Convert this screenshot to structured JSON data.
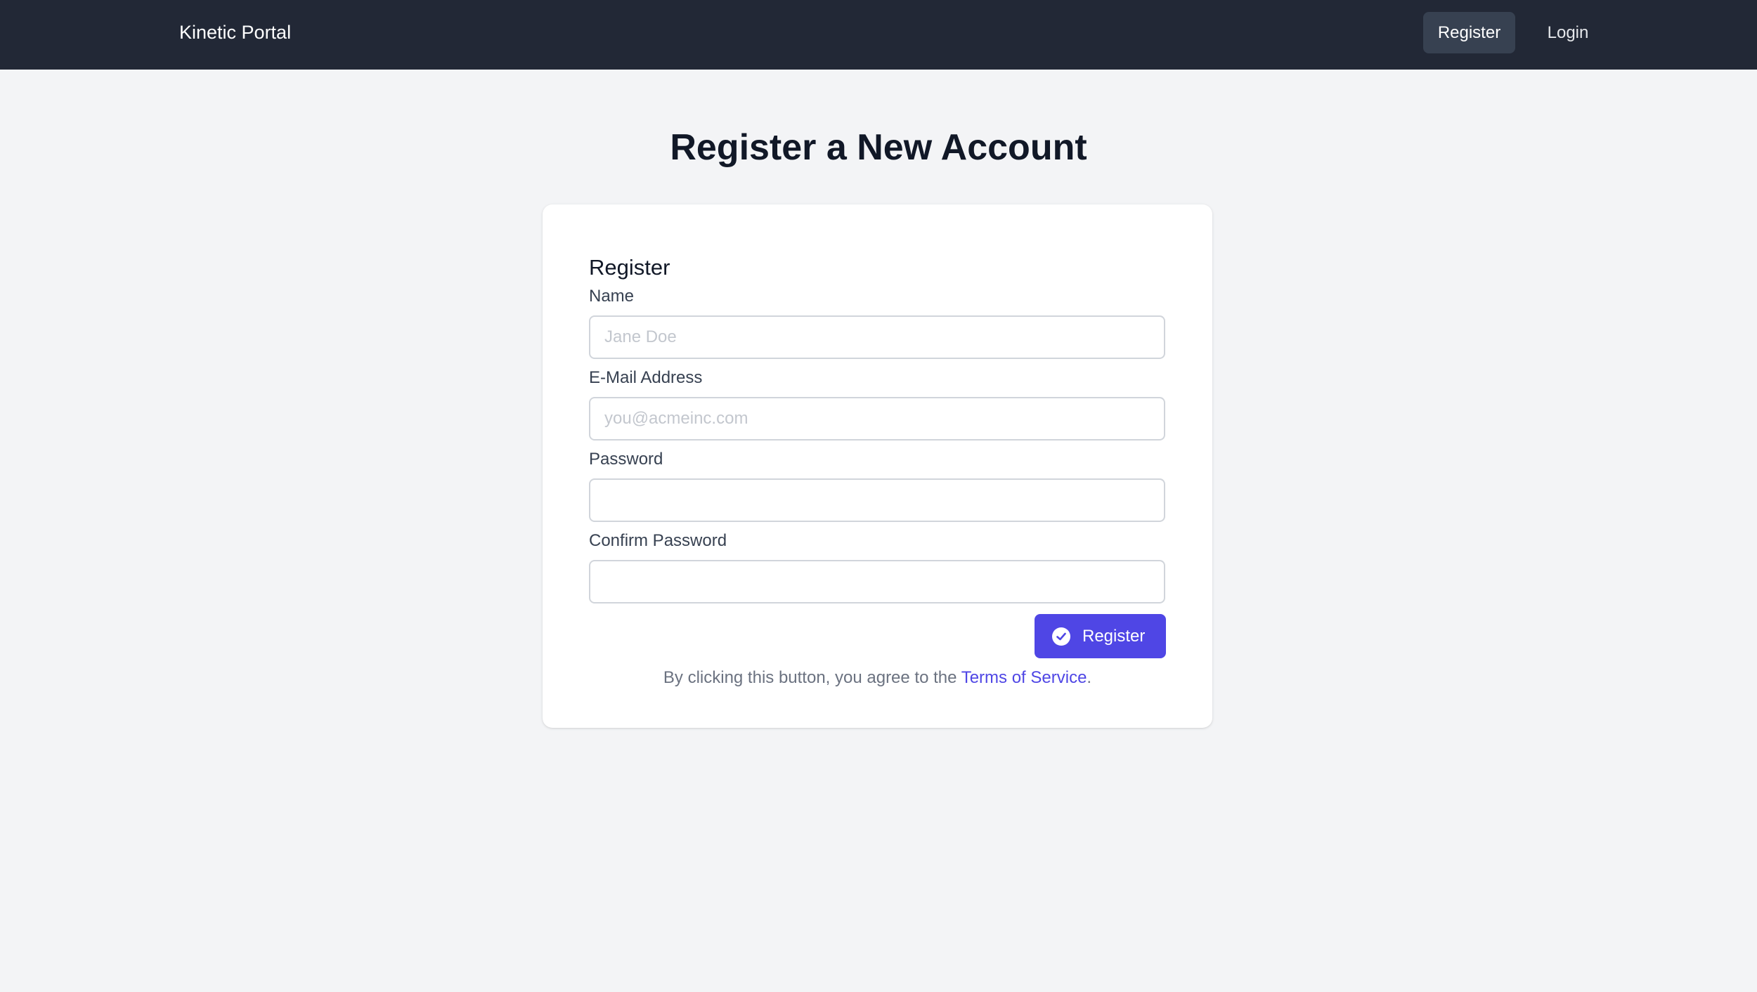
{
  "navbar": {
    "brand": "Kinetic Portal",
    "register_label": "Register",
    "login_label": "Login"
  },
  "page": {
    "title": "Register a New Account"
  },
  "form": {
    "heading": "Register",
    "fields": [
      {
        "label": "Name",
        "placeholder": "Jane Doe",
        "value": ""
      },
      {
        "label": "E-Mail Address",
        "placeholder": "you@acmeinc.com",
        "value": ""
      },
      {
        "label": "Password",
        "placeholder": "",
        "value": ""
      },
      {
        "label": "Confirm Password",
        "placeholder": "",
        "value": ""
      }
    ],
    "submit_label": "Register",
    "submit_icon": "check-circle-icon",
    "terms_prefix": "By clicking this button, you agree to the ",
    "terms_link": "Terms of Service",
    "terms_suffix": "."
  },
  "colors": {
    "navbar_bg": "#222836",
    "accent": "#4f46e5",
    "page_bg": "#f3f4f6"
  }
}
